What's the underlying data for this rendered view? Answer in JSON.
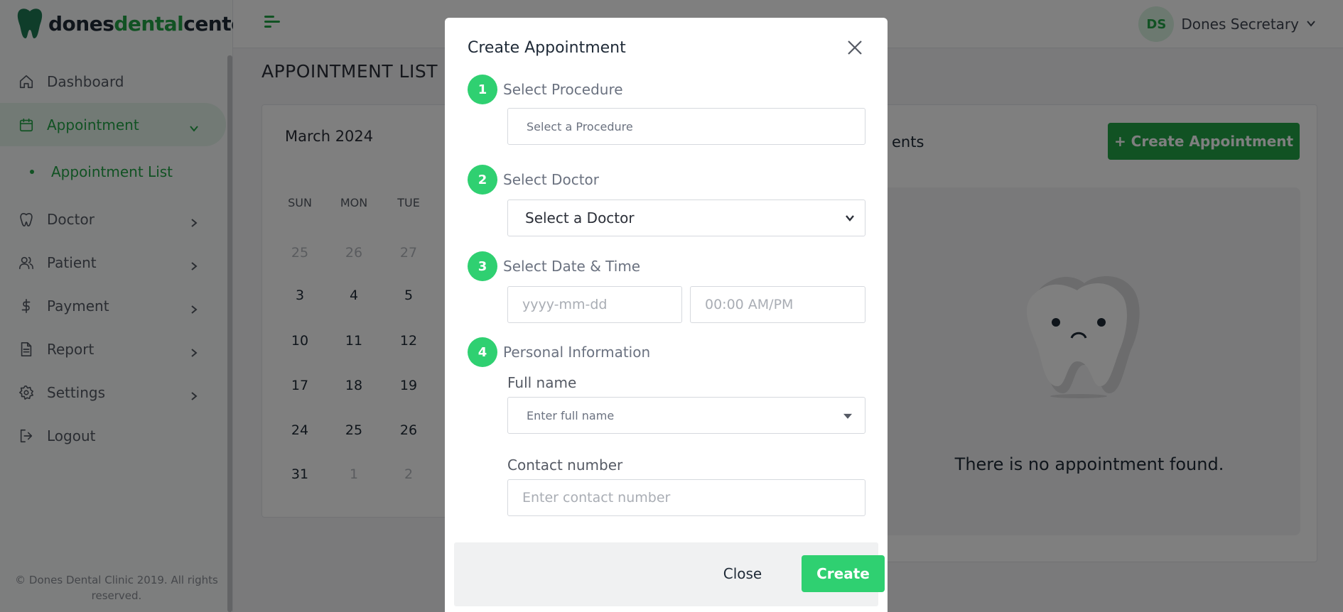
{
  "brand": {
    "logo_part1": "dones",
    "logo_part2": "dental",
    "logo_part3": "center",
    "accent": "#22a447",
    "step_color": "#2fd071"
  },
  "sidebar": {
    "items": [
      {
        "label": "Dashboard",
        "icon": "home-icon"
      },
      {
        "label": "Appointment",
        "icon": "calendar-icon",
        "active": true,
        "expanded": true
      },
      {
        "label": "Doctor",
        "icon": "tooth-icon"
      },
      {
        "label": "Patient",
        "icon": "users-icon"
      },
      {
        "label": "Payment",
        "icon": "dollar-icon"
      },
      {
        "label": "Report",
        "icon": "document-icon"
      },
      {
        "label": "Settings",
        "icon": "gear-icon"
      },
      {
        "label": "Logout",
        "icon": "logout-icon"
      }
    ],
    "subitem": "Appointment List",
    "copyright_line1": "© Dones Dental Clinic 2019. All rights",
    "copyright_line2": "reserved."
  },
  "header": {
    "avatar_initials": "DS",
    "user_name": "Dones Secretary"
  },
  "main": {
    "page_title": "APPOINTMENT LIST",
    "calendar": {
      "month": "March 2024",
      "weekdays": [
        "SUN",
        "MON",
        "TUE"
      ],
      "rows": [
        [
          {
            "d": "25",
            "m": true
          },
          {
            "d": "26",
            "m": true
          },
          {
            "d": "27",
            "m": true
          }
        ],
        [
          {
            "d": "3"
          },
          {
            "d": "4"
          },
          {
            "d": "5"
          }
        ],
        [
          {
            "d": "10"
          },
          {
            "d": "11"
          },
          {
            "d": "12"
          }
        ],
        [
          {
            "d": "17"
          },
          {
            "d": "18"
          },
          {
            "d": "19"
          }
        ],
        [
          {
            "d": "24"
          },
          {
            "d": "25"
          },
          {
            "d": "26"
          }
        ],
        [
          {
            "d": "31"
          },
          {
            "d": "1",
            "m": true
          },
          {
            "d": "2",
            "m": true
          }
        ]
      ]
    },
    "appointments_heading": "ents",
    "create_appointment_button": "+ Create Appointment",
    "empty_message": "There is no appointment found."
  },
  "modal": {
    "title": "Create Appointment",
    "steps": [
      {
        "num": "1",
        "label": "Select Procedure"
      },
      {
        "num": "2",
        "label": "Select Doctor"
      },
      {
        "num": "3",
        "label": "Select Date & Time"
      },
      {
        "num": "4",
        "label": "Personal Information"
      }
    ],
    "procedure_placeholder": "Select a Procedure",
    "doctor_selected": "Select a Doctor",
    "date_placeholder": "yyyy-mm-dd",
    "time_placeholder": "00:00 AM/PM",
    "fullname_label": "Full name",
    "fullname_placeholder": "Enter full name",
    "contact_label": "Contact number",
    "contact_placeholder": "Enter contact number",
    "close_button": "Close",
    "create_button": "Create"
  }
}
